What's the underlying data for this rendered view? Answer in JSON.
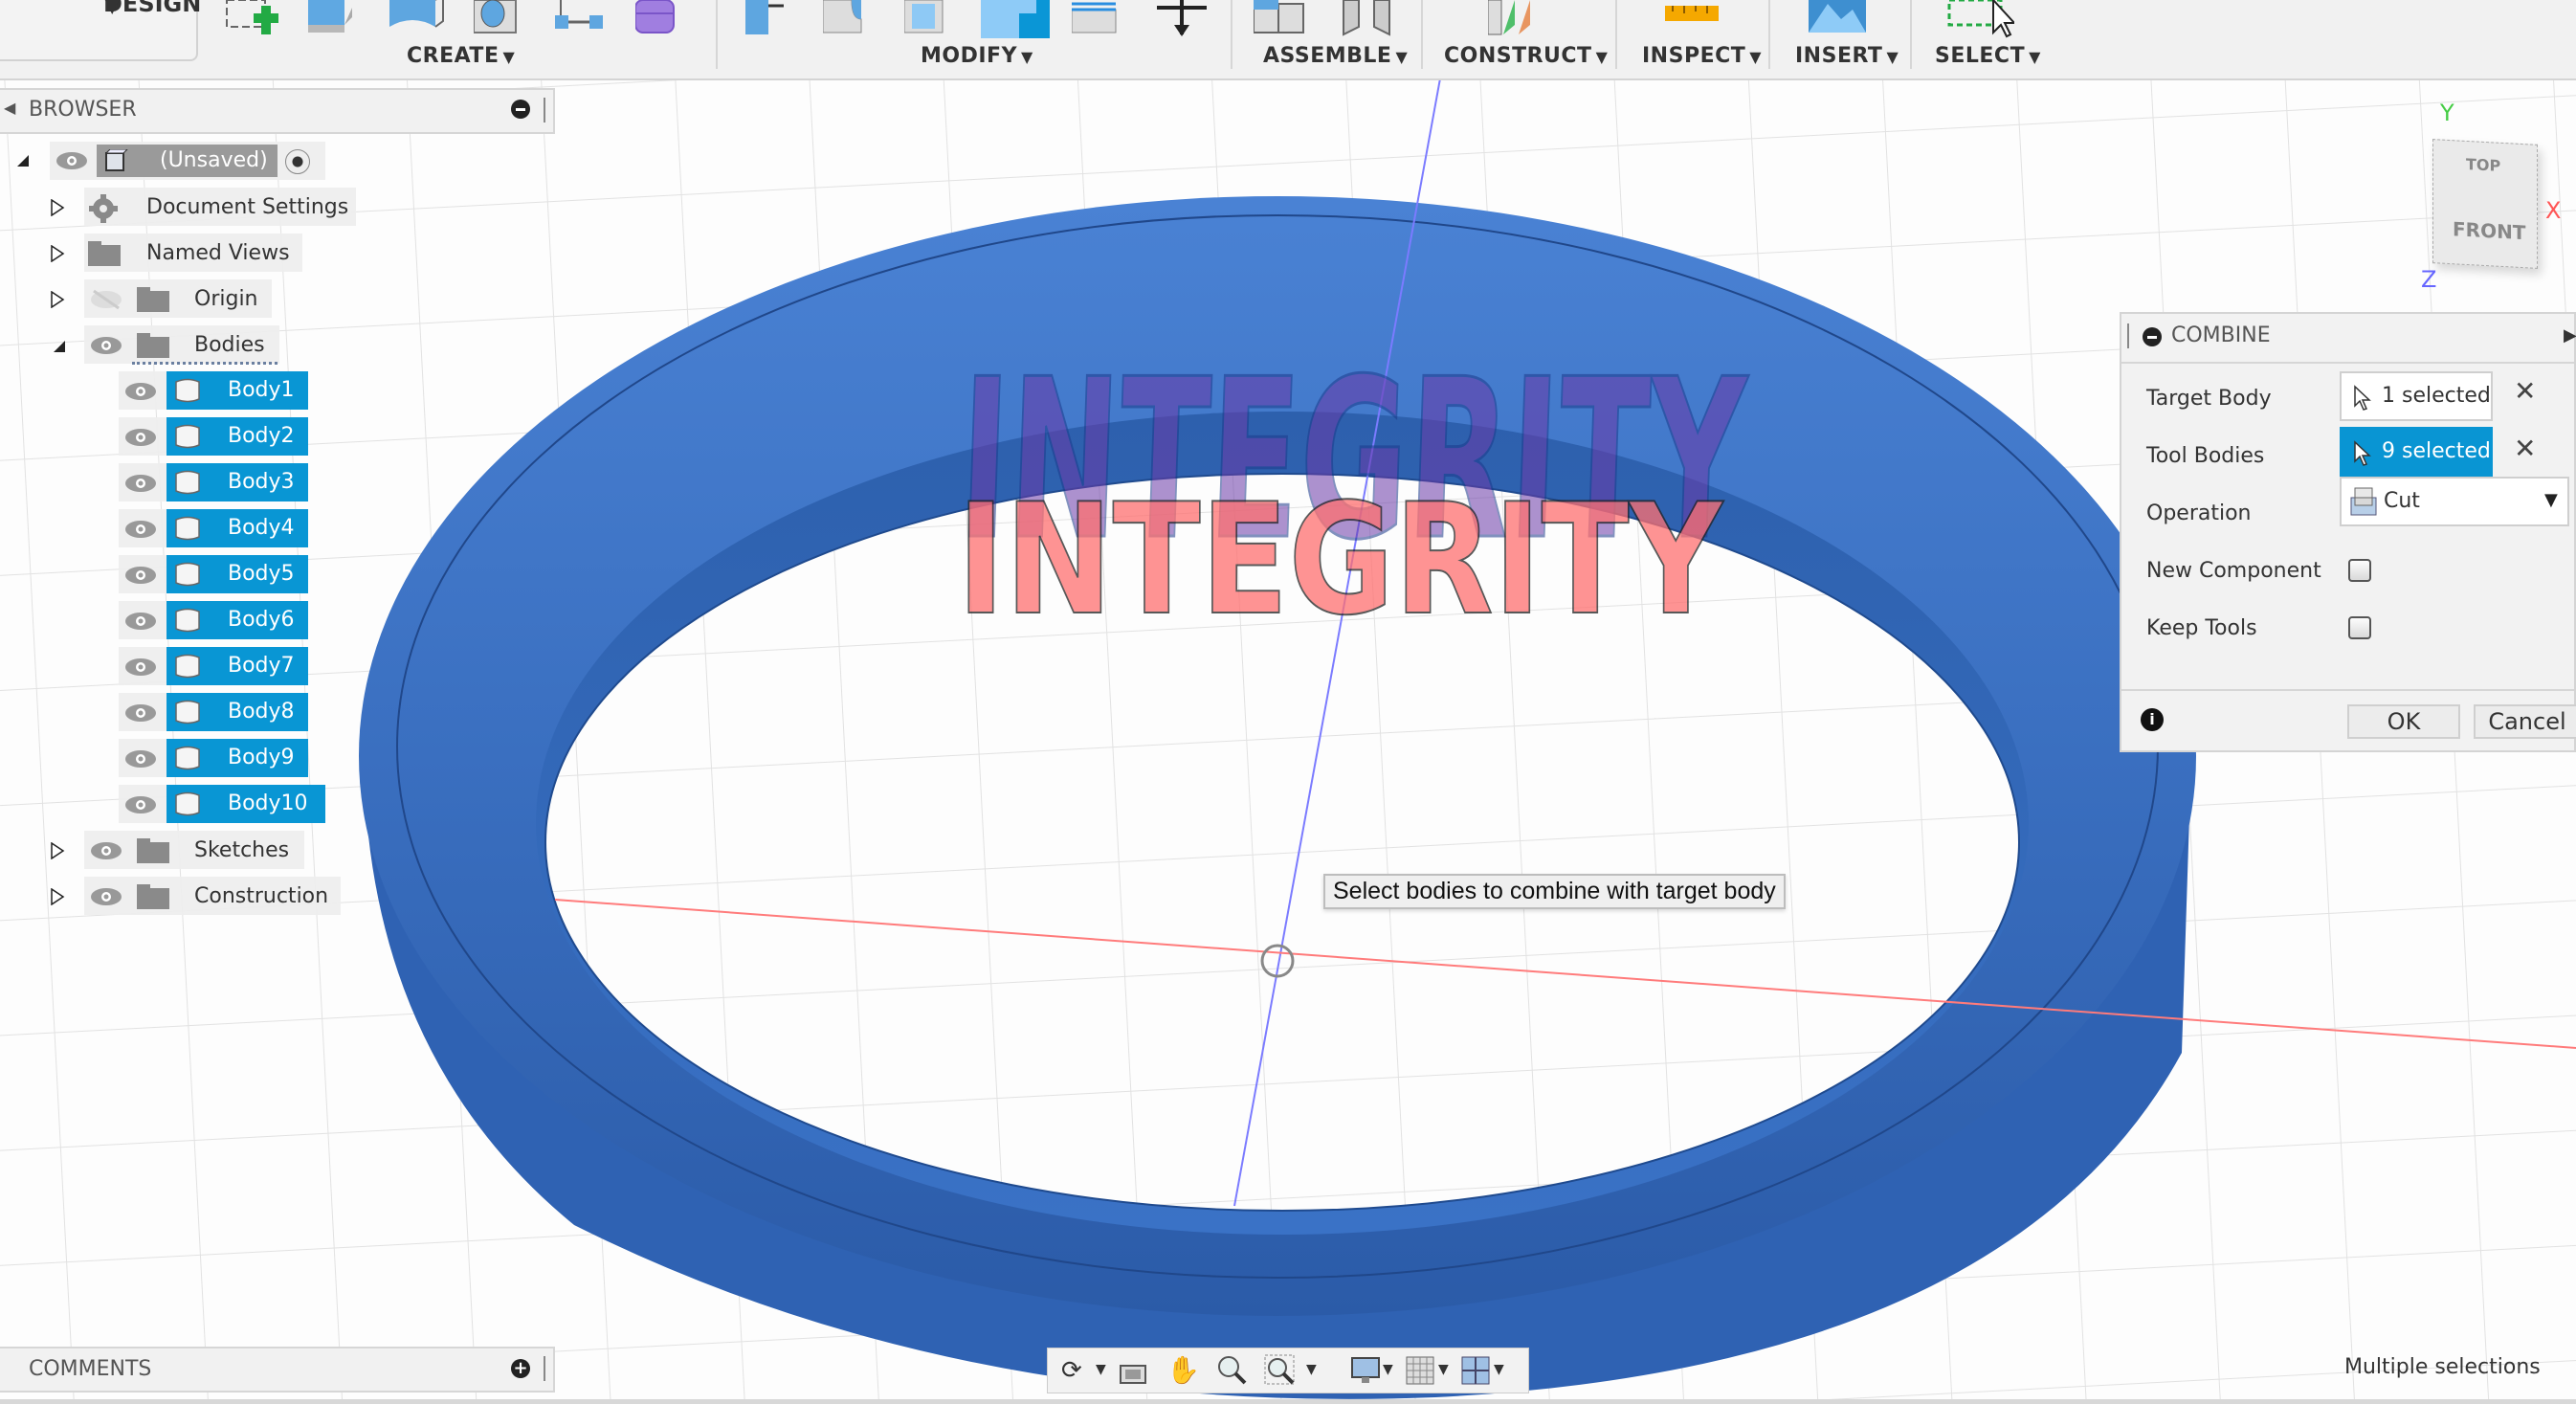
{
  "toolbar": {
    "workspace": "DESIGN",
    "groups": [
      {
        "label": "CREATE"
      },
      {
        "label": "MODIFY"
      },
      {
        "label": "ASSEMBLE"
      },
      {
        "label": "CONSTRUCT"
      },
      {
        "label": "INSPECT"
      },
      {
        "label": "INSERT"
      },
      {
        "label": "SELECT"
      }
    ],
    "caret": "▼"
  },
  "browser": {
    "title": "BROWSER",
    "root": {
      "label": "(Unsaved)"
    },
    "items": [
      {
        "label": "Document Settings",
        "icon": "gear-icon",
        "visible_toggle": false
      },
      {
        "label": "Named Views",
        "icon": "folder-icon",
        "visible_toggle": false
      },
      {
        "label": "Origin",
        "icon": "folder-icon",
        "visible_toggle": true,
        "hidden": true
      },
      {
        "label": "Bodies",
        "icon": "folder-icon",
        "visible_toggle": true,
        "expanded": true
      }
    ],
    "bodies": [
      {
        "label": "Body1"
      },
      {
        "label": "Body2"
      },
      {
        "label": "Body3"
      },
      {
        "label": "Body4"
      },
      {
        "label": "Body5"
      },
      {
        "label": "Body6"
      },
      {
        "label": "Body7"
      },
      {
        "label": "Body8"
      },
      {
        "label": "Body9"
      },
      {
        "label": "Body10"
      }
    ],
    "after": [
      {
        "label": "Sketches"
      },
      {
        "label": "Construction"
      }
    ]
  },
  "comments": {
    "title": "COMMENTS"
  },
  "combine": {
    "title": "COMBINE",
    "target_body": {
      "label": "Target Body",
      "value": "1 selected"
    },
    "tool_bodies": {
      "label": "Tool Bodies",
      "value": "9 selected"
    },
    "operation": {
      "label": "Operation",
      "value": "Cut"
    },
    "new_component": {
      "label": "New Component",
      "checked": false
    },
    "keep_tools": {
      "label": "Keep Tools",
      "checked": false
    },
    "ok": "OK",
    "cancel": "Cancel"
  },
  "viewcube": {
    "top": "TOP",
    "front": "FRONT",
    "x": "X",
    "y": "Y",
    "z": "Z"
  },
  "viewport": {
    "tooltip": "Select bodies to combine with target body",
    "text_model": "INTEGRITY",
    "colors": {
      "ring": "#3a6fc0",
      "ring_dark": "#2a569f",
      "tool_red": "#ff6b6b",
      "selection": "#0996d4"
    }
  },
  "status": {
    "text": "Multiple selections"
  }
}
